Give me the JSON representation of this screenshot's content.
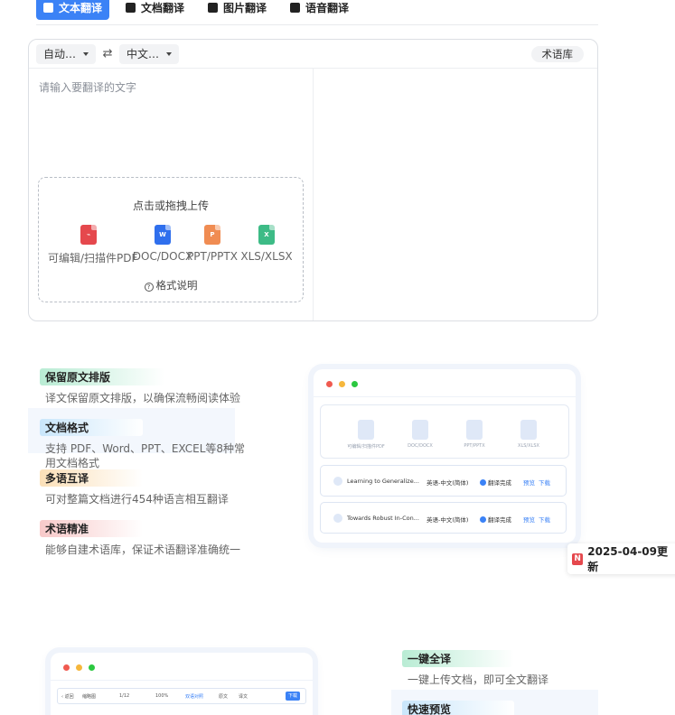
{
  "tabs": [
    {
      "label": "文本翻译",
      "active": true,
      "icon": "text-doc-icon"
    },
    {
      "label": "文档翻译",
      "active": false,
      "icon": "document-icon"
    },
    {
      "label": "图片翻译",
      "active": false,
      "icon": "image-icon"
    },
    {
      "label": "语音翻译",
      "active": false,
      "icon": "audio-icon"
    }
  ],
  "translator": {
    "source_lang": "自动…",
    "target_lang": "中文…",
    "swap_icon": "swap-arrows-icon",
    "glossary_label": "术语库",
    "placeholder": "请输入要翻译的文字",
    "upload": {
      "title": "点击或拖拽上传",
      "formats": [
        {
          "label": "可编辑/扫描件PDF",
          "icon": "pdf-file-icon",
          "color": "#e5484d"
        },
        {
          "label": "DOC/DOCX",
          "icon": "word-file-icon",
          "color": "#2f6fed"
        },
        {
          "label": "PPT/PPTX",
          "icon": "ppt-file-icon",
          "color": "#f08c52"
        },
        {
          "label": "XLS/XLSX",
          "icon": "excel-file-icon",
          "color": "#3dbb86"
        }
      ],
      "help_label": "格式说明"
    }
  },
  "features_doc": [
    {
      "title": "保留原文排版",
      "desc": "译文保留原文排版，以确保流畅阅读体验",
      "accent": "#b9ecd4"
    },
    {
      "title": "文档格式",
      "desc": "支持 PDF、Word、PPT、EXCEL等8种常用文档格式",
      "accent": "#c9e6fb"
    },
    {
      "title": "多语互译",
      "desc": "可对整篇文档进行454种语言相互翻译",
      "accent": "#fbe0b8"
    },
    {
      "title": "术语精准",
      "desc": "能够自建术语库，保证术语翻译准确统一",
      "accent": "#f8c9c9"
    }
  ],
  "preview1": {
    "formats": [
      "可编辑/扫描件PDF",
      "DOC/DOCX",
      "PPT/PPTX",
      "XLS/XLSX"
    ],
    "rows": [
      {
        "name": "Learning to Generalize...",
        "lang": "英语-中文(简体)",
        "status": "翻译完成",
        "preview": "预览",
        "download": "下载"
      },
      {
        "name": "Towards Robust In-Con...",
        "lang": "英语-中文(简体)",
        "status": "翻译完成",
        "preview": "预览",
        "download": "下载"
      }
    ]
  },
  "update_tag": {
    "badge": "N",
    "label": "2025-04-09更新",
    "arrow": "›"
  },
  "preview2": {
    "toolbar": {
      "back": "‹ 返回",
      "thumbs": "缩略图",
      "page": "1/12",
      "zoom": "100%",
      "bilingual": "双语对照",
      "original": "原文",
      "translated": "译文",
      "download": "下载"
    }
  },
  "features_quick": [
    {
      "title": "一键全译",
      "desc": "一键上传文档，即可全文翻译",
      "accent": "#b9ecd4"
    },
    {
      "title": "快速预览",
      "desc": "",
      "accent": "#c9e6fb"
    }
  ],
  "colors": {
    "primary": "#3b82f6",
    "dot_red": "#f05a50",
    "dot_yellow": "#f6b73c",
    "dot_green": "#2bc840"
  }
}
